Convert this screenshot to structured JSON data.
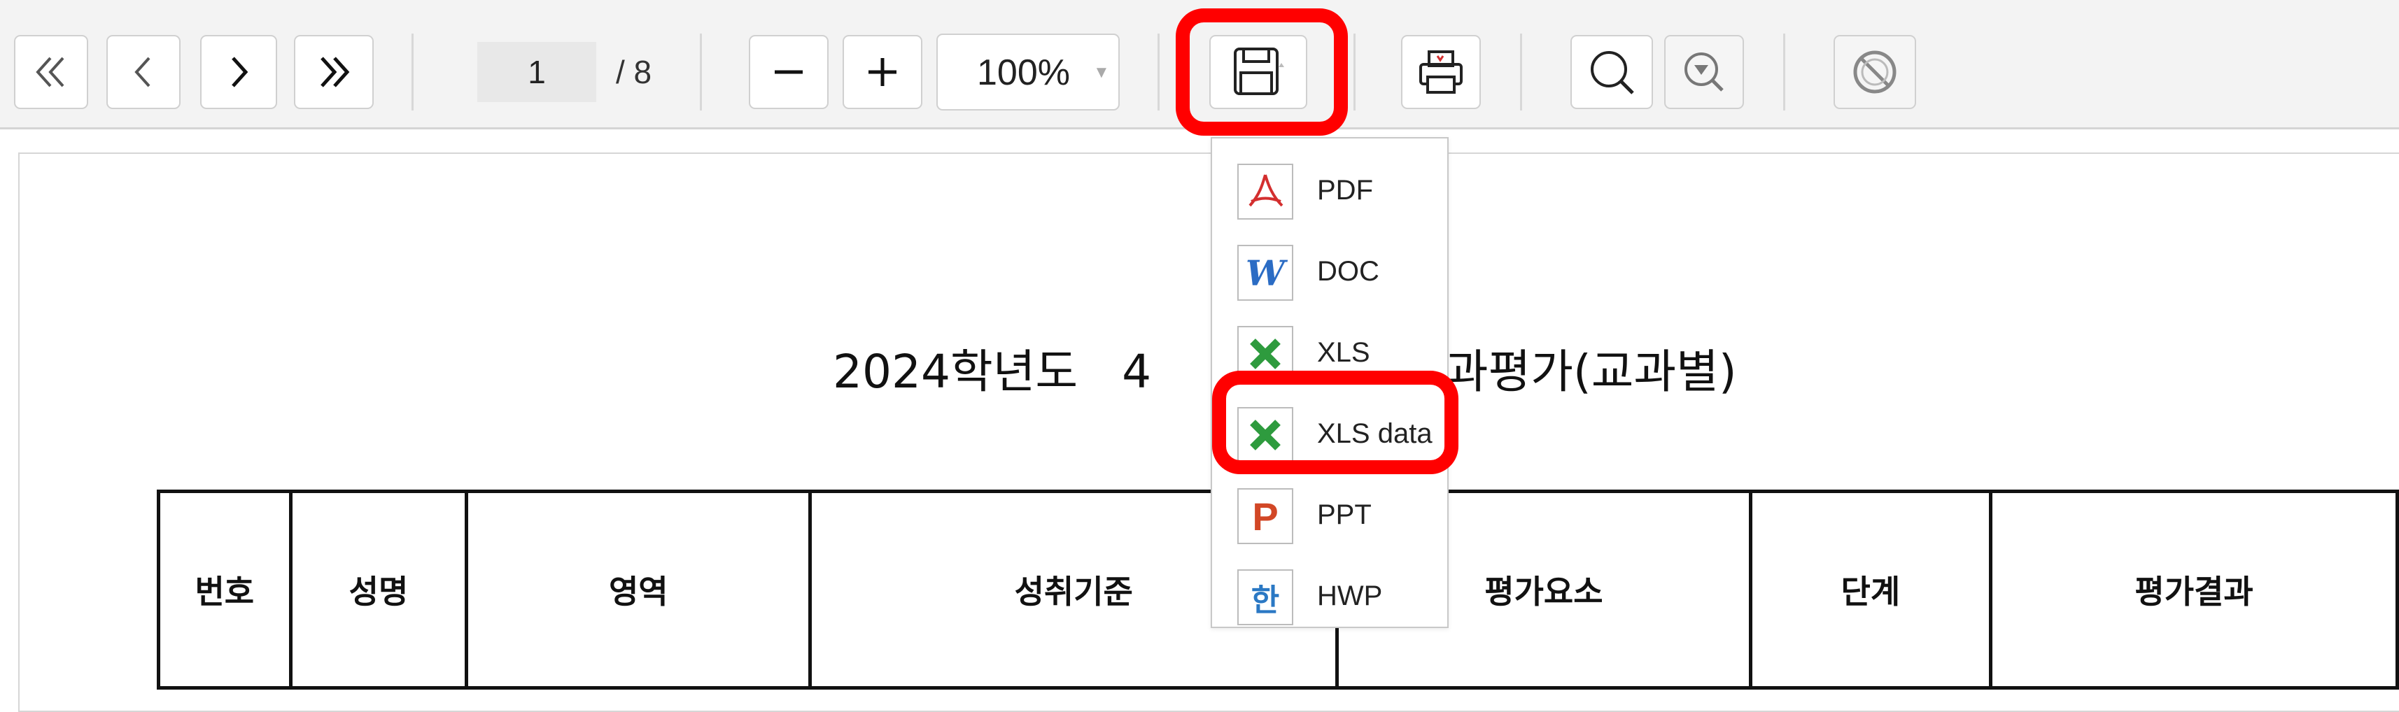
{
  "toolbar": {
    "current_page": "1",
    "total_pages": "/ 8",
    "zoom_value": "100%",
    "icons": [
      "first-page-icon",
      "prev-page-icon",
      "next-page-icon",
      "last-page-icon",
      "zoom-out-icon",
      "zoom-in-icon",
      "save-icon",
      "print-icon",
      "search-icon",
      "search-option-icon",
      "cancel-icon"
    ]
  },
  "export_menu": {
    "items": [
      {
        "label": "PDF",
        "icon": "pdf-icon",
        "color": "#d32f2f"
      },
      {
        "label": "DOC",
        "icon": "word-icon",
        "color": "#2b6cc4"
      },
      {
        "label": "XLS",
        "icon": "excel-icon",
        "color": "#2e9b3e"
      },
      {
        "label": "XLS data",
        "icon": "excel-icon",
        "color": "#2e9b3e"
      },
      {
        "label": "PPT",
        "icon": "powerpoint-icon",
        "color": "#d24726"
      },
      {
        "label": "HWP",
        "icon": "hwp-icon",
        "color": "#2a78c4"
      }
    ]
  },
  "document": {
    "title_left": "2024학년도   4",
    "title_right": "교과평가(교과별)",
    "table_headers": [
      "번호",
      "성명",
      "영역",
      "성취기준",
      "평가요소",
      "단계",
      "평가결과"
    ]
  },
  "colors": {
    "highlight": "#ff0000",
    "toolbar_bg": "#f3f3f3"
  }
}
